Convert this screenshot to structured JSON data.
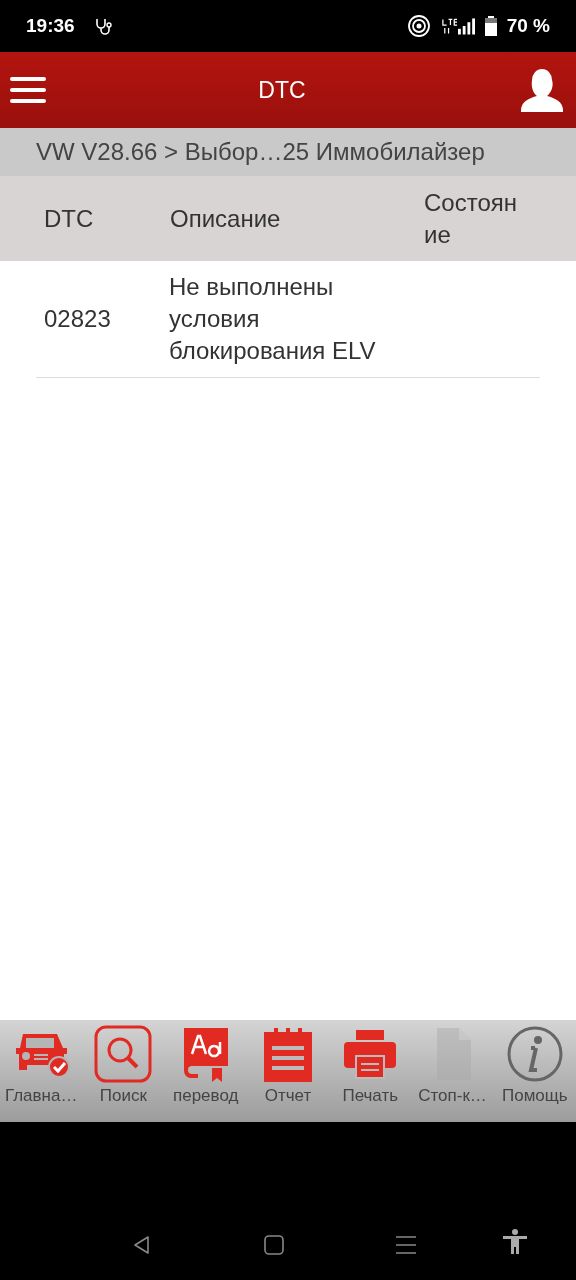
{
  "status_bar": {
    "time": "19:36",
    "battery": "70 %"
  },
  "header": {
    "title": "DTC"
  },
  "breadcrumb": "VW V28.66 > Выбор…25 Иммобилайзер",
  "table": {
    "columns": [
      "DTC",
      "Описание",
      "Состоян ие"
    ],
    "rows": [
      {
        "code": "02823",
        "description": "Не выполнены условия блокирования ELV",
        "status": ""
      }
    ]
  },
  "toolbar": [
    {
      "kind": "car",
      "label": "Главна…",
      "disabled": false
    },
    {
      "kind": "search",
      "label": "Поиск",
      "disabled": false
    },
    {
      "kind": "translate",
      "label": "перевод",
      "disabled": false
    },
    {
      "kind": "report",
      "label": "Отчет",
      "disabled": false
    },
    {
      "kind": "print",
      "label": "Печать",
      "disabled": false
    },
    {
      "kind": "document",
      "label": "Стоп-к…",
      "disabled": true
    },
    {
      "kind": "help",
      "label": "Помощь",
      "disabled": false
    }
  ]
}
